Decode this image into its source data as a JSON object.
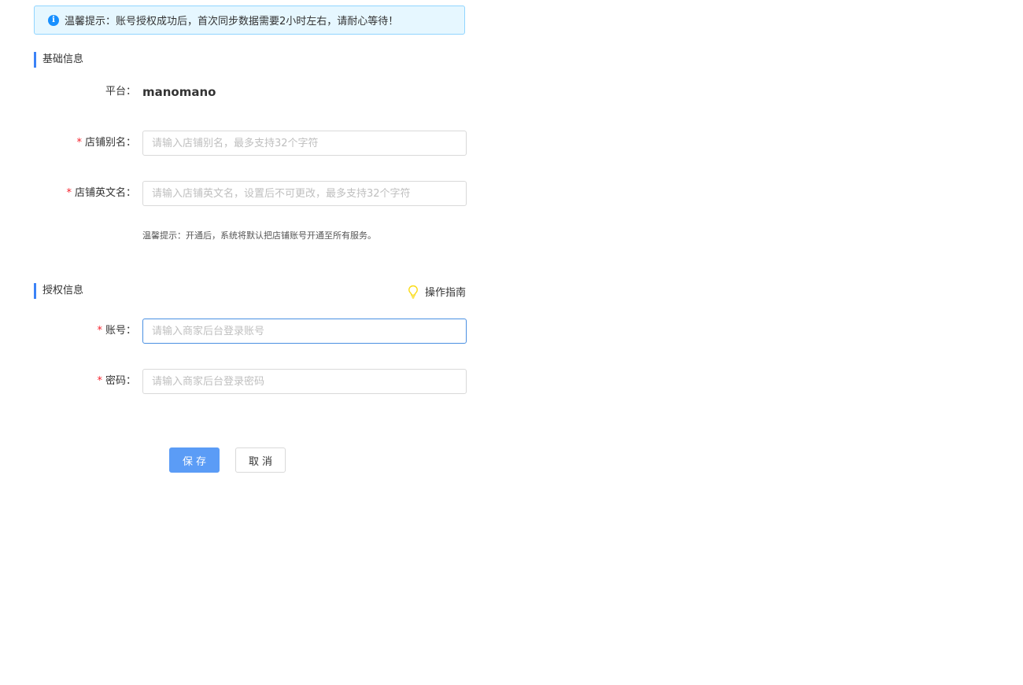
{
  "alert": {
    "text": "温馨提示：账号授权成功后，首次同步数据需要2小时左右，请耐心等待！",
    "icon": "info-icon"
  },
  "sections": {
    "basic": "基础信息",
    "auth": "授权信息"
  },
  "guide": {
    "label": "操作指南",
    "icon": "bulb-icon"
  },
  "form": {
    "platform": {
      "label": "平台：",
      "value": "manomano"
    },
    "shop_alias": {
      "required": "*",
      "label": "店铺别名：",
      "placeholder": "请输入店铺别名，最多支持32个字符",
      "value": ""
    },
    "shop_en_name": {
      "required": "*",
      "label": "店铺英文名：",
      "placeholder": "请输入店铺英文名，设置后不可更改，最多支持32个字符",
      "value": ""
    },
    "tip": "温馨提示：开通后，系统将默认把店铺账号开通至所有服务。",
    "account": {
      "required": "*",
      "label": "账号：",
      "placeholder": "请输入商家后台登录账号",
      "value": ""
    },
    "password": {
      "required": "*",
      "label": "密码：",
      "placeholder": "请输入商家后台登录密码",
      "value": ""
    }
  },
  "buttons": {
    "save": "保存",
    "cancel": "取消"
  },
  "colors": {
    "primary": "#5b9cf6",
    "accent_bar": "#3b82f6",
    "required": "#f5222d",
    "alert_bg": "#e6f7ff",
    "alert_border": "#91d5ff"
  }
}
